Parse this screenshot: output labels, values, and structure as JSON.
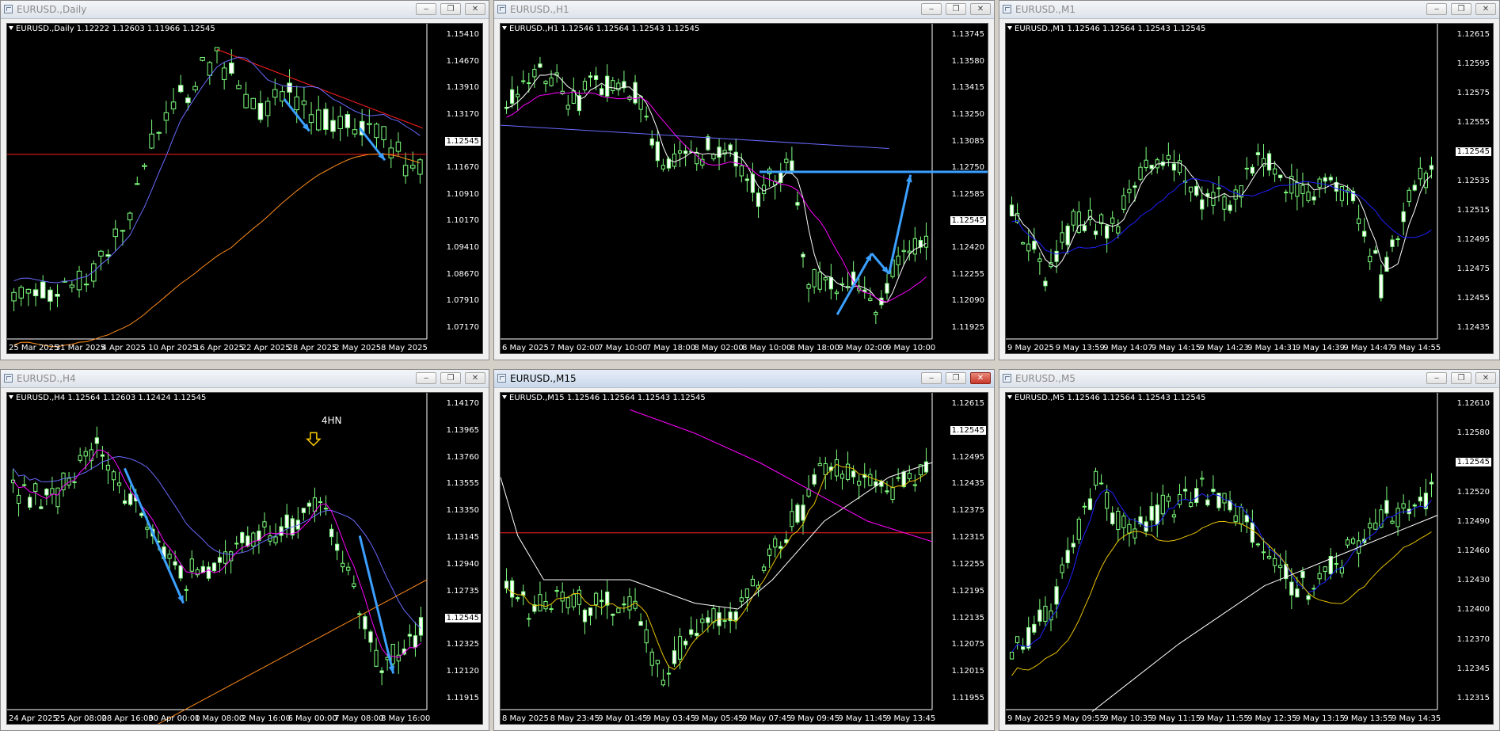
{
  "colors": {
    "up": "#7dff7d",
    "bull_body": "#000000",
    "bear_body": "#ffffff",
    "ma_white": "#ffffff",
    "ma_blue": "#6a6aff",
    "ma_magenta": "#ff00ff",
    "ma_orange": "#ff8c1a",
    "ma_yellow": "#e6c200",
    "trend_red": "#ff2020",
    "arrow_blue": "#3ba0ff"
  },
  "windows": [
    {
      "id": "daily",
      "title": "EURUSD.,Daily",
      "active": false,
      "info": "EURUSD.,Daily  1.12222 1.12603 1.11966 1.12545",
      "ylabels": [
        "1.15410",
        "1.14670",
        "1.13910",
        "1.13170",
        "1.12545",
        "1.11670",
        "1.10910",
        "1.10170",
        "1.09410",
        "1.08670",
        "1.07910",
        "1.07170"
      ],
      "price_label": "1.12545",
      "xlabels": [
        "25 Mar 2025",
        "31 Mar 2025",
        "4 Apr 2025",
        "10 Apr 2025",
        "16 Apr 2025",
        "22 Apr 2025",
        "28 Apr 2025",
        "2 May 2025",
        "8 May 2025"
      ],
      "annotation": ""
    },
    {
      "id": "h1",
      "title": "EURUSD.,H1",
      "active": false,
      "info": "EURUSD.,H1  1.12546 1.12564 1.12543 1.12545",
      "ylabels": [
        "1.13745",
        "1.13580",
        "1.13415",
        "1.13250",
        "1.13085",
        "1.12750",
        "1.12585",
        "1.12545",
        "1.12420",
        "1.12255",
        "1.12090",
        "1.11925"
      ],
      "price_label": "1.12545",
      "xlabels": [
        "6 May 2025",
        "7 May 02:00",
        "7 May 10:00",
        "7 May 18:00",
        "8 May 02:00",
        "8 May 10:00",
        "8 May 18:00",
        "9 May 02:00",
        "9 May 10:00"
      ],
      "annotation": ""
    },
    {
      "id": "m1",
      "title": "EURUSD.,M1",
      "active": false,
      "info": "EURUSD.,M1  1.12546 1.12564 1.12543 1.12545",
      "ylabels": [
        "1.12615",
        "1.12595",
        "1.12575",
        "1.12555",
        "1.12545",
        "1.12535",
        "1.12515",
        "1.12495",
        "1.12475",
        "1.12455",
        "1.12435"
      ],
      "price_label": "1.12545",
      "xlabels": [
        "9 May 2025",
        "9 May 13:59",
        "9 May 14:07",
        "9 May 14:15",
        "9 May 14:23",
        "9 May 14:31",
        "9 May 14:39",
        "9 May 14:47",
        "9 May 14:55"
      ],
      "annotation": ""
    },
    {
      "id": "h4",
      "title": "EURUSD.,H4",
      "active": false,
      "info": "EURUSD.,H4  1.12564 1.12603 1.12424 1.12545",
      "ylabels": [
        "1.14170",
        "1.13965",
        "1.13760",
        "1.13555",
        "1.13350",
        "1.13145",
        "1.12940",
        "1.12735",
        "1.12545",
        "1.12325",
        "1.12120",
        "1.11915"
      ],
      "price_label": "1.12545",
      "xlabels": [
        "24 Apr 2025",
        "25 Apr 08:00",
        "28 Apr 16:00",
        "30 Apr 00:00",
        "1 May 08:00",
        "2 May 16:00",
        "6 May 00:00",
        "7 May 08:00",
        "8 May 16:00"
      ],
      "annotation": "4HN"
    },
    {
      "id": "m15",
      "title": "EURUSD.,M15",
      "active": true,
      "info": "EURUSD.,M15  1.12546 1.12564 1.12543 1.12545",
      "ylabels": [
        "1.12615",
        "1.12545",
        "1.12495",
        "1.12435",
        "1.12375",
        "1.12315",
        "1.12255",
        "1.12195",
        "1.12135",
        "1.12075",
        "1.12015",
        "1.11955"
      ],
      "price_label": "1.12545",
      "xlabels": [
        "8 May 2025",
        "8 May 23:45",
        "9 May 01:45",
        "9 May 03:45",
        "9 May 05:45",
        "9 May 07:45",
        "9 May 09:45",
        "9 May 11:45",
        "9 May 13:45"
      ],
      "annotation": ""
    },
    {
      "id": "m5",
      "title": "EURUSD.,M5",
      "active": false,
      "info": "EURUSD.,M5  1.12546 1.12564 1.12543 1.12545",
      "ylabels": [
        "1.12610",
        "1.12580",
        "1.12545",
        "1.12520",
        "1.12490",
        "1.12460",
        "1.12430",
        "1.12400",
        "1.12370",
        "1.12345",
        "1.12315"
      ],
      "price_label": "1.12545",
      "xlabels": [
        "9 May 2025",
        "9 May 09:55",
        "9 May 10:35",
        "9 May 11:15",
        "9 May 11:55",
        "9 May 12:35",
        "9 May 13:15",
        "9 May 13:55",
        "9 May 14:35"
      ],
      "annotation": ""
    }
  ],
  "buttons": {
    "minimize": "‒",
    "restore": "❐",
    "close": "✕"
  }
}
